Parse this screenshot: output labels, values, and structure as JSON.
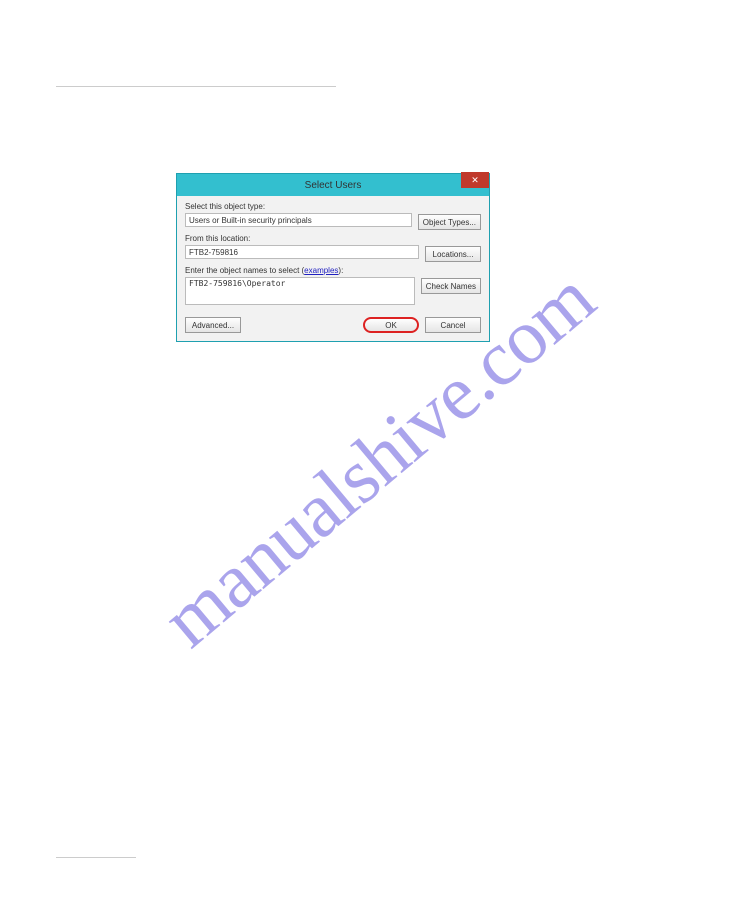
{
  "watermark": "manualshive.com",
  "dialog": {
    "title": "Select Users",
    "close_label": "✕",
    "object_type_label": "Select this object type:",
    "object_type_value": "Users or Built-in security principals",
    "object_types_btn": "Object Types...",
    "location_label": "From this location:",
    "location_value": "FTB2-759816",
    "locations_btn": "Locations...",
    "names_label_prefix": "Enter the object names to select (",
    "names_label_link": "examples",
    "names_label_suffix": "):",
    "names_value": "FTB2-759816\\Operator",
    "check_names_btn": "Check Names",
    "advanced_btn": "Advanced...",
    "ok_btn": "OK",
    "cancel_btn": "Cancel"
  }
}
